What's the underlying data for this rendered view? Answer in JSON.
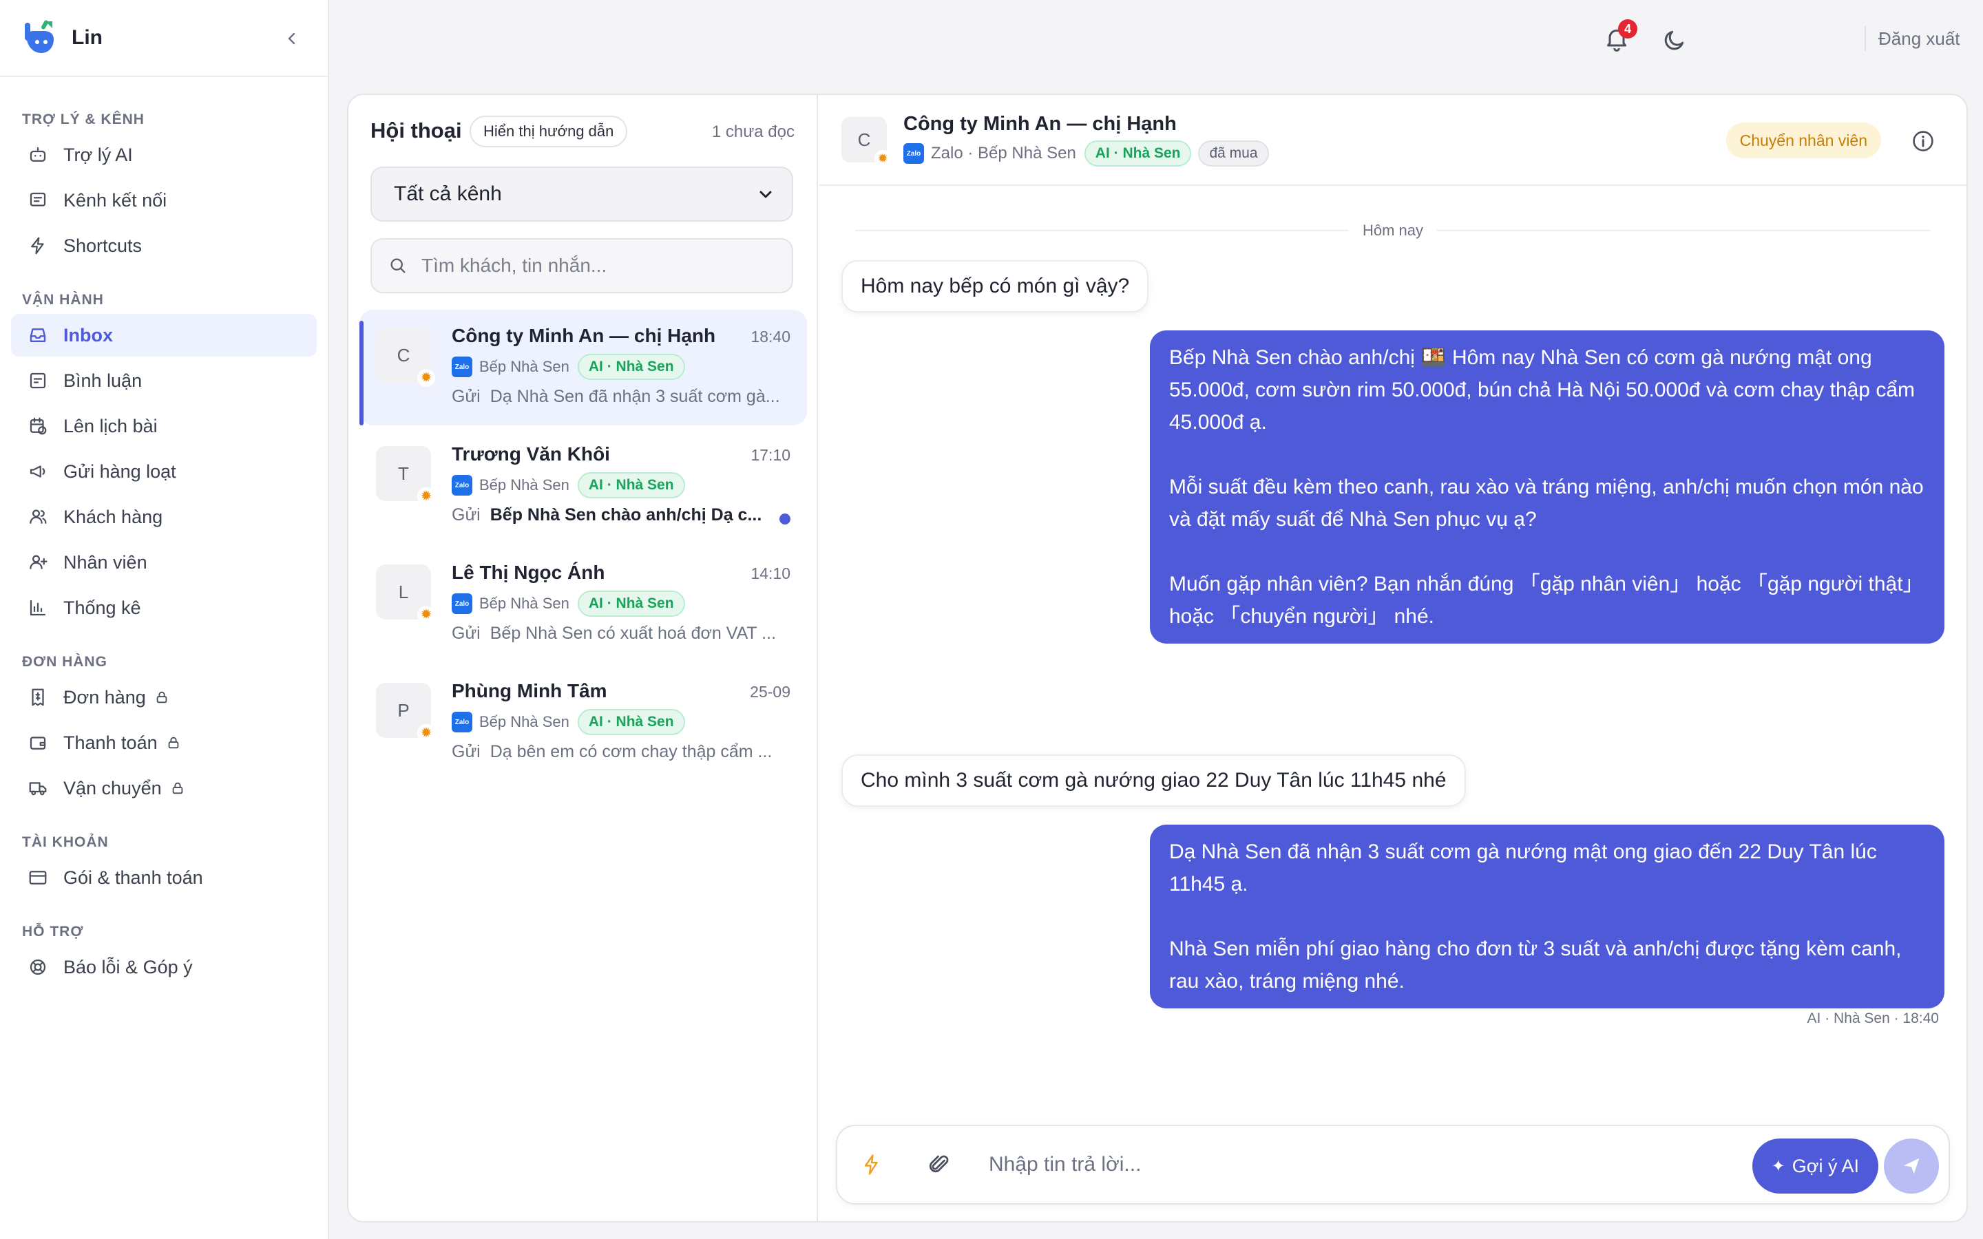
{
  "app": {
    "name": "Lin"
  },
  "colors": {
    "accent": "#4f5ad9",
    "ai_tag_green": "#17a35a",
    "transfer_amber": "#c77c06",
    "badge_red": "#e3262f"
  },
  "sidebar": {
    "sections": [
      {
        "title": "TRỢ LÝ & KÊNH",
        "items": [
          {
            "label": "Trợ lý AI",
            "icon": "bot-icon"
          },
          {
            "label": "Kênh kết nối",
            "icon": "message-square-icon"
          },
          {
            "label": "Shortcuts",
            "icon": "zap-icon"
          }
        ]
      },
      {
        "title": "VẬN HÀNH",
        "items": [
          {
            "label": "Inbox",
            "icon": "inbox-icon",
            "active": true
          },
          {
            "label": "Bình luận",
            "icon": "comment-icon"
          },
          {
            "label": "Lên lịch bài",
            "icon": "calendar-clock-icon"
          },
          {
            "label": "Gửi hàng loạt",
            "icon": "megaphone-icon"
          },
          {
            "label": "Khách hàng",
            "icon": "users-icon"
          },
          {
            "label": "Nhân viên",
            "icon": "user-plus-icon"
          },
          {
            "label": "Thống kê",
            "icon": "bar-chart-icon"
          }
        ]
      },
      {
        "title": "ĐƠN HÀNG",
        "items": [
          {
            "label": "Đơn hàng",
            "icon": "receipt-icon",
            "locked": true
          },
          {
            "label": "Thanh toán",
            "icon": "wallet-icon",
            "locked": true
          },
          {
            "label": "Vận chuyển",
            "icon": "truck-icon",
            "locked": true
          }
        ]
      },
      {
        "title": "TÀI KHOẢN",
        "items": [
          {
            "label": "Gói & thanh toán",
            "icon": "credit-card-icon"
          }
        ]
      },
      {
        "title": "HỖ TRỢ",
        "items": [
          {
            "label": "Báo lỗi & Góp ý",
            "icon": "lifebuoy-icon"
          }
        ]
      }
    ]
  },
  "topbar": {
    "notification_count": "4",
    "logout_label": "Đăng xuất"
  },
  "conversations": {
    "title": "Hội thoại",
    "guide_label": "Hiển thị hướng dẫn",
    "unread_label": "1 chưa đọc",
    "channel_filter": "Tất cả kênh",
    "search_placeholder": "Tìm khách, tin nhắn...",
    "items": [
      {
        "initial": "C",
        "name": "Công ty Minh An — chị Hạnh",
        "time": "18:40",
        "page": "Bếp Nhà Sen",
        "ai_tag": "AI · Nhà Sen",
        "preview_prefix": "Gửi",
        "preview": "Dạ Nhà Sen đã nhận 3 suất cơm gà...",
        "active": true,
        "unread": false
      },
      {
        "initial": "T",
        "name": "Trương Văn Khôi",
        "time": "17:10",
        "page": "Bếp Nhà Sen",
        "ai_tag": "AI · Nhà Sen",
        "preview_prefix": "Gửi",
        "preview": "Bếp Nhà Sen chào anh/chị Dạ c...",
        "active": false,
        "unread": true
      },
      {
        "initial": "L",
        "name": "Lê Thị Ngọc Ánh",
        "time": "14:10",
        "page": "Bếp Nhà Sen",
        "ai_tag": "AI · Nhà Sen",
        "preview_prefix": "Gửi",
        "preview": "Bếp Nhà Sen có xuất hoá đơn VAT ...",
        "active": false,
        "unread": false
      },
      {
        "initial": "P",
        "name": "Phùng Minh Tâm",
        "time": "25-09",
        "page": "Bếp Nhà Sen",
        "ai_tag": "AI · Nhà Sen",
        "preview_prefix": "Gửi",
        "preview": "Dạ bên em có cơm chay thập cẩm ...",
        "active": false,
        "unread": false
      }
    ]
  },
  "chat": {
    "initial": "C",
    "name": "Công ty Minh An — chị Hạnh",
    "channel": "Zalo · Bếp Nhà Sen",
    "ai_tag": "AI · Nhà Sen",
    "status_tag": "đã mua",
    "transfer_label": "Chuyển nhân viên",
    "day_label": "Hôm nay",
    "messages": [
      {
        "dir": "in",
        "text": "Hôm nay bếp có món gì vậy?"
      },
      {
        "dir": "out",
        "paragraphs": [
          "Bếp Nhà Sen chào anh/chị 🍱 Hôm nay Nhà Sen có cơm gà nướng mật ong 55.000đ, cơm sườn rim 50.000đ, bún chả Hà Nội 50.000đ và cơm chay thập cẩm 45.000đ ạ.",
          "Mỗi suất đều kèm theo canh, rau xào và tráng miệng, anh/chị muốn chọn món nào và đặt mấy suất để Nhà Sen phục vụ ạ?",
          "Muốn gặp nhân viên? Bạn nhắn đúng 「gặp nhân viên」 hoặc 「gặp người thật」 hoặc 「chuyển người」 nhé."
        ]
      },
      {
        "dir": "in",
        "text": "Cho mình 3 suất cơm gà nướng giao 22 Duy Tân lúc 11h45 nhé"
      },
      {
        "dir": "out",
        "paragraphs": [
          "Dạ Nhà Sen đã nhận 3 suất cơm gà nướng mật ong giao đến 22 Duy Tân lúc 11h45 ạ.",
          "Nhà Sen miễn phí giao hàng cho đơn từ 3 suất và anh/chị được tặng kèm canh, rau xào, tráng miệng nhé."
        ],
        "signature": "AI · Nhà Sen · 18:40"
      }
    ],
    "composer": {
      "placeholder": "Nhập tin trả lời...",
      "ai_suggest_label": "Gợi ý AI"
    }
  }
}
